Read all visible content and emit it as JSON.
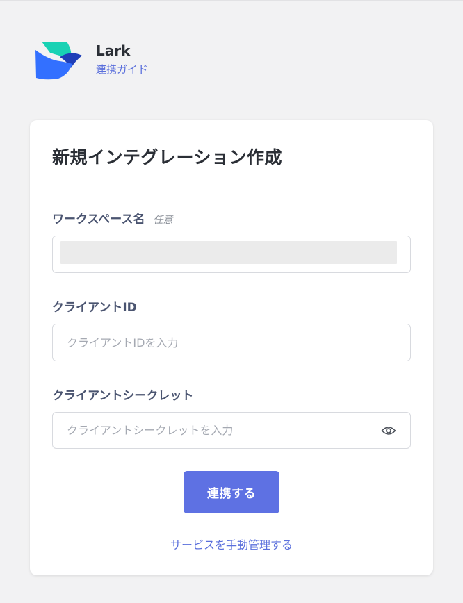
{
  "brand": {
    "name": "Lark",
    "guide_link": "連携ガイド"
  },
  "form": {
    "title": "新規インテグレーション作成",
    "workspace": {
      "label": "ワークスペース名",
      "optional_tag": "任意",
      "value": ""
    },
    "client_id": {
      "label": "クライアントID",
      "placeholder": "クライアントIDを入力"
    },
    "client_secret": {
      "label": "クライアントシークレット",
      "placeholder": "クライアントシークレットを入力",
      "toggle_icon": "eye-icon"
    },
    "submit_label": "連携する",
    "manual_link": "サービスを手動管理する"
  },
  "colors": {
    "background": "#f2f2f3",
    "accent": "#5e71e3",
    "link": "#5a6fdc",
    "label": "#4a5470",
    "logo_teal": "#19d2b4",
    "logo_blue": "#3370ff",
    "logo_navy": "#1f3fb8"
  }
}
